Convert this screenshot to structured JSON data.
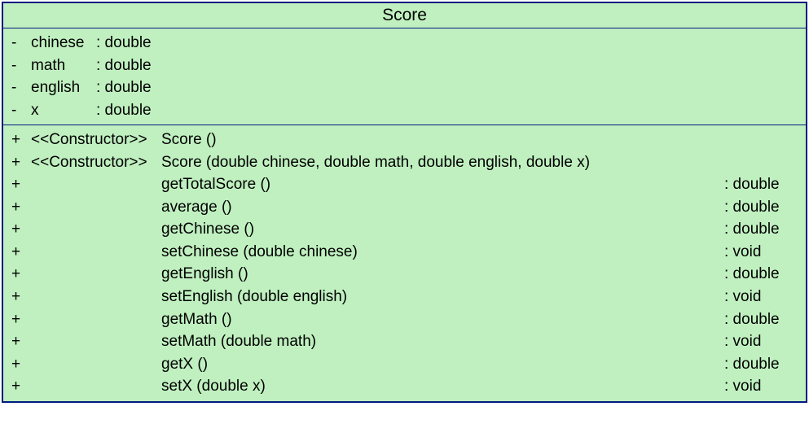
{
  "className": "Score",
  "attributes": [
    {
      "visibility": "-",
      "name": "chinese",
      "type": "double"
    },
    {
      "visibility": "-",
      "name": "math",
      "type": "double"
    },
    {
      "visibility": "-",
      "name": "english",
      "type": "double"
    },
    {
      "visibility": "-",
      "name": "x",
      "type": "double"
    }
  ],
  "operations": [
    {
      "visibility": "+",
      "stereotype": "<<Constructor>>",
      "signature": "Score ()",
      "returnType": ""
    },
    {
      "visibility": "+",
      "stereotype": "<<Constructor>>",
      "signature": "Score (double chinese, double math, double english, double x)",
      "returnType": ""
    },
    {
      "visibility": "+",
      "stereotype": "",
      "signature": "getTotalScore ()",
      "returnType": ": double"
    },
    {
      "visibility": "+",
      "stereotype": "",
      "signature": "average ()",
      "returnType": ": double"
    },
    {
      "visibility": "+",
      "stereotype": "",
      "signature": "getChinese ()",
      "returnType": ": double"
    },
    {
      "visibility": "+",
      "stereotype": "",
      "signature": "setChinese (double chinese)",
      "returnType": ": void"
    },
    {
      "visibility": "+",
      "stereotype": "",
      "signature": "getEnglish ()",
      "returnType": ": double"
    },
    {
      "visibility": "+",
      "stereotype": "",
      "signature": "setEnglish (double english)",
      "returnType": ": void"
    },
    {
      "visibility": "+",
      "stereotype": "",
      "signature": "getMath ()",
      "returnType": ": double"
    },
    {
      "visibility": "+",
      "stereotype": "",
      "signature": "setMath (double math)",
      "returnType": ": void"
    },
    {
      "visibility": "+",
      "stereotype": "",
      "signature": "getX ()",
      "returnType": ": double"
    },
    {
      "visibility": "+",
      "stereotype": "",
      "signature": "setX (double x)",
      "returnType": ": void"
    }
  ]
}
